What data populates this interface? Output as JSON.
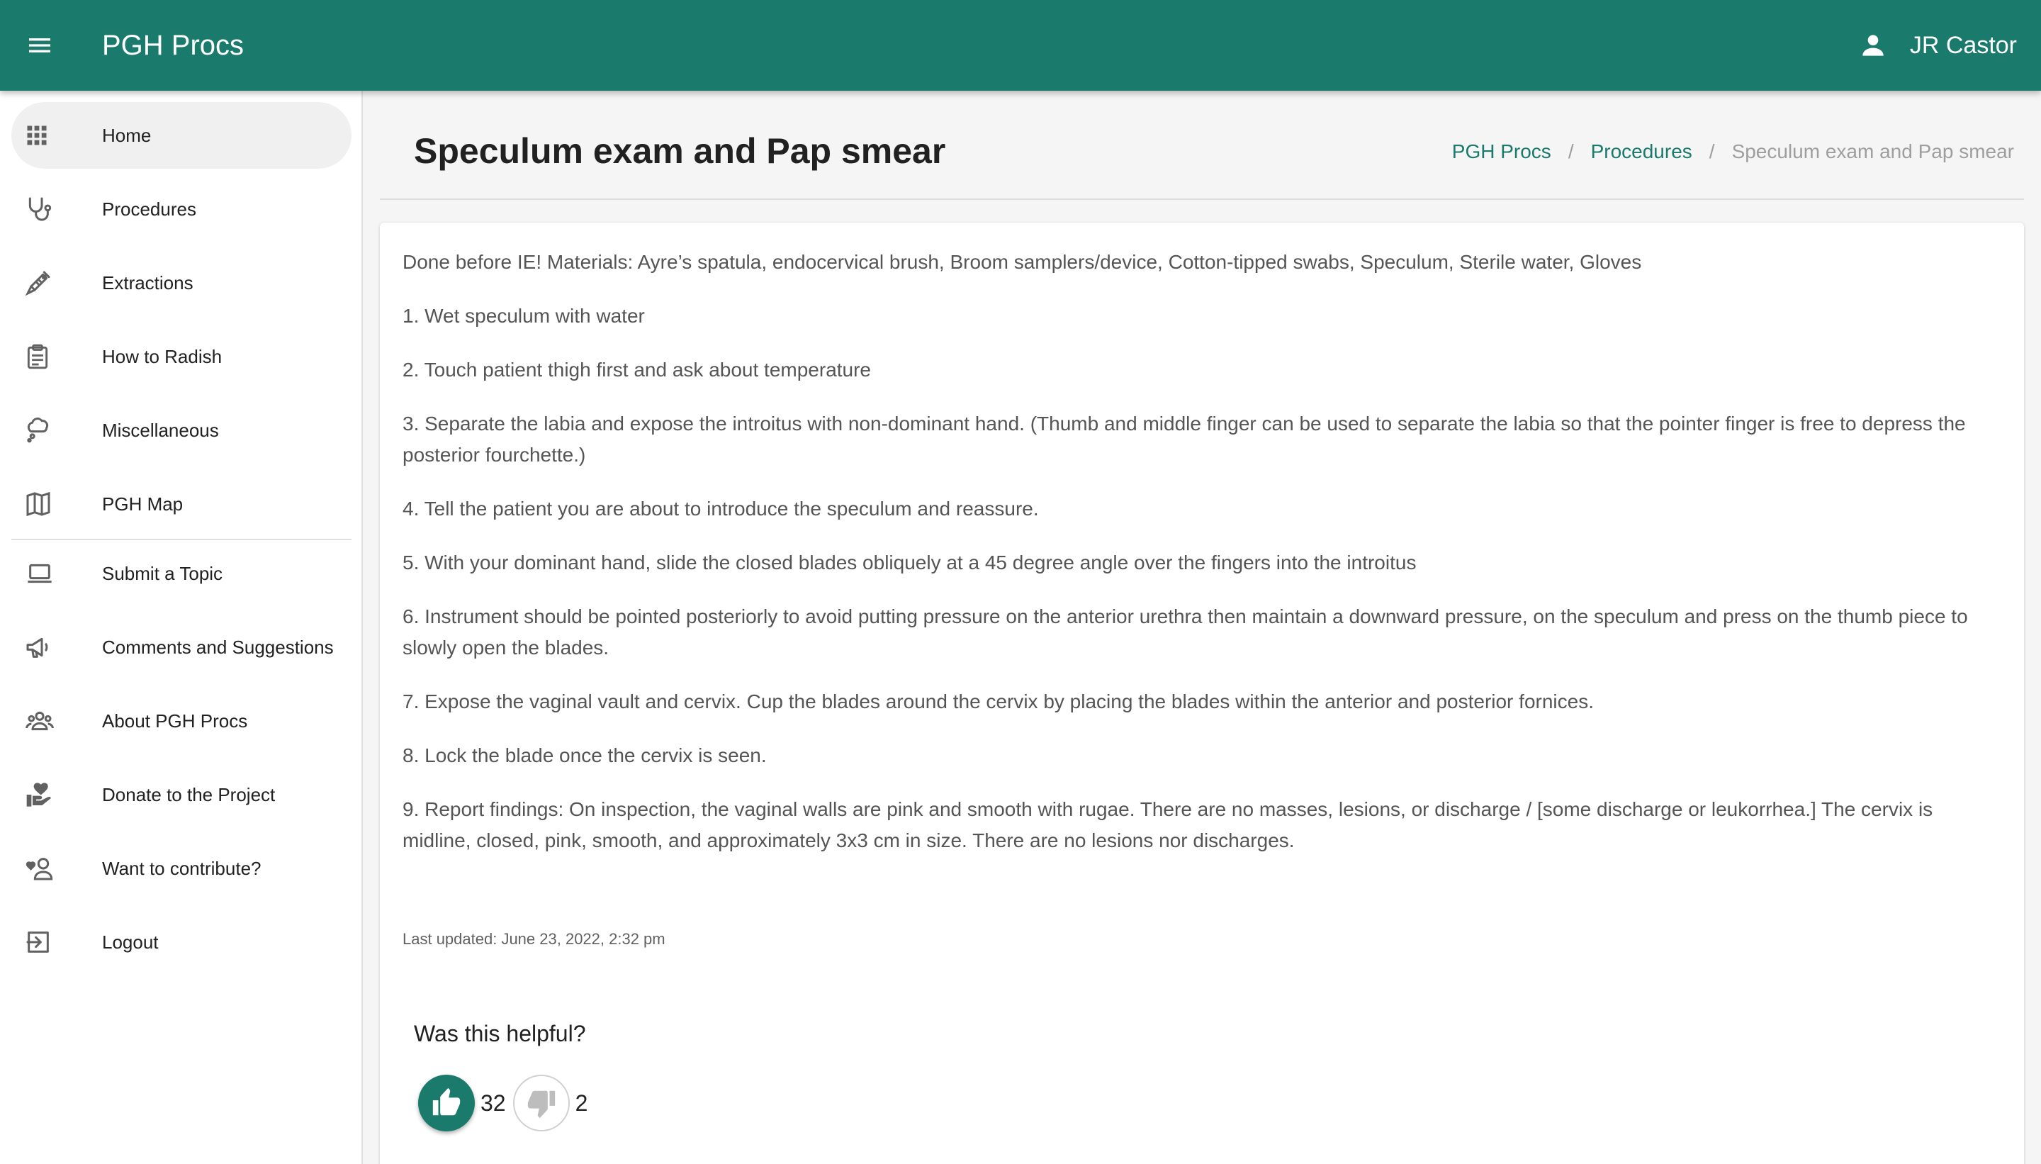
{
  "app": {
    "title": "PGH Procs",
    "user_name": "JR Castor",
    "accent_color": "#1a7a6c"
  },
  "sidebar": {
    "items": [
      {
        "label": "Home",
        "icon": "grid-icon",
        "active": true
      },
      {
        "label": "Procedures",
        "icon": "stethoscope-icon"
      },
      {
        "label": "Extractions",
        "icon": "syringe-icon"
      },
      {
        "label": "How to Radish",
        "icon": "clipboard-icon"
      },
      {
        "label": "Miscellaneous",
        "icon": "thought-bubble-icon"
      },
      {
        "label": "PGH Map",
        "icon": "map-icon"
      },
      {
        "label": "Submit a Topic",
        "icon": "laptop-icon"
      },
      {
        "label": "Comments and Suggestions",
        "icon": "megaphone-icon"
      },
      {
        "label": "About PGH Procs",
        "icon": "group-icon"
      },
      {
        "label": "Donate to the Project",
        "icon": "donate-icon"
      },
      {
        "label": "Want to contribute?",
        "icon": "contributor-icon"
      },
      {
        "label": "Logout",
        "icon": "logout-icon"
      }
    ]
  },
  "page": {
    "title": "Speculum exam and Pap smear",
    "breadcrumb": [
      "PGH Procs",
      "Procedures",
      "Speculum exam and Pap smear"
    ],
    "paragraphs": [
      "Done before IE! Materials: Ayre’s spatula, endocervical brush, Broom samplers/device, Cotton-tipped swabs, Speculum, Sterile water, Gloves",
      "1. Wet speculum with water",
      "2. Touch patient thigh first and ask about temperature",
      "3. Separate the labia and expose the introitus with non-dominant hand. (Thumb and middle finger can be used to separate the labia so that the pointer finger is free to depress the posterior fourchette.)",
      "4. Tell the patient you are about to introduce the speculum and reassure.",
      "5. With your dominant hand, slide the closed blades obliquely at a 45 degree angle over the fingers into the introitus",
      "6. Instrument should be pointed posteriorly to avoid putting pressure on the anterior urethra then maintain a downward pressure, on the speculum and press on the thumb piece to slowly open the blades.",
      "7. Expose the vaginal vault and cervix. Cup the blades around the cervix by placing the blades within the anterior and posterior fornices.",
      "8. Lock the blade once the cervix is seen.",
      "9. Report findings: On inspection, the vaginal walls are pink and smooth with rugae. There are no masses, lesions, or discharge / [some discharge or leukorrhea.] The cervix is midline, closed, pink, smooth, and approximately 3x3 cm in size. There are no lesions nor discharges."
    ],
    "last_updated": "Last updated: June 23, 2022, 2:32 pm"
  },
  "feedback": {
    "question": "Was this helpful?",
    "likes": "32",
    "dislikes": "2"
  }
}
